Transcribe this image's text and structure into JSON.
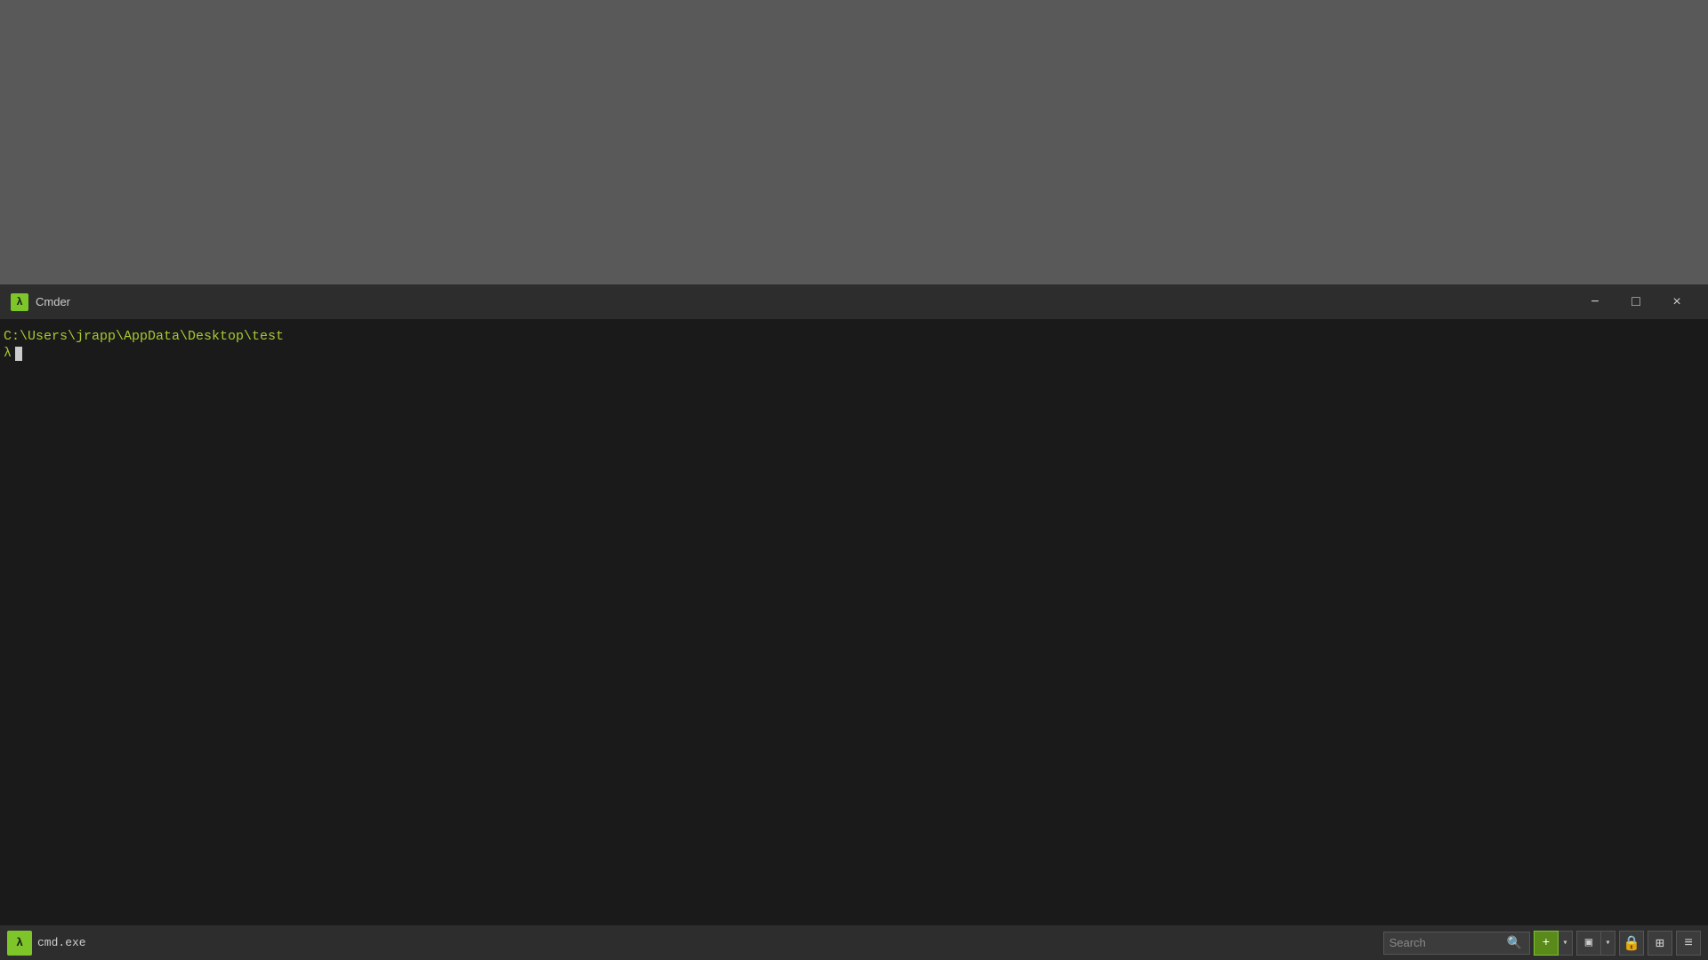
{
  "desktop": {
    "bg_color": "#595959"
  },
  "title_bar": {
    "icon_label": "λ",
    "title": "Cmder",
    "minimize_label": "−",
    "maximize_label": "□",
    "close_label": "×",
    "bg_color": "#2d2d2d"
  },
  "terminal": {
    "bg_color": "#1a1a1a",
    "path_line": "C:\\Users\\jrapp\\AppData\\Desktop\\test",
    "lambda_prompt": "λ",
    "prompt_color": "#a8c832"
  },
  "status_bar": {
    "icon_label": "λ",
    "process_name": "cmd.exe",
    "search_placeholder": "Search",
    "search_value": "",
    "bg_color": "#2d2d2d"
  },
  "toolbar": {
    "add_icon": "+",
    "dropdown_icon": "▾",
    "split_icon": "▣",
    "split_dropdown": "▾",
    "lock_icon": "🔒",
    "grid_icon": "⊞",
    "menu_icon": "≡"
  }
}
